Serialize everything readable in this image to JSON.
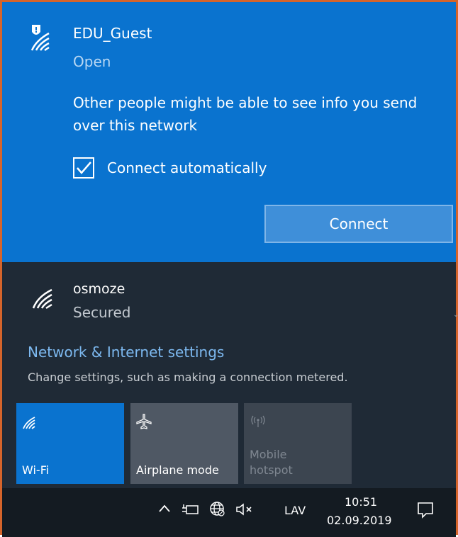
{
  "selected_network": {
    "ssid": "EDU_Guest",
    "status": "Open",
    "warning": "Other people might be able to see info you send over this network",
    "connect_automatically_label": "Connect automatically",
    "connect_automatically_checked": true,
    "connect_button_label": "Connect",
    "icon": "wifi-shield-warning-icon"
  },
  "networks": [
    {
      "ssid": "osmoze",
      "status": "Secured",
      "icon": "wifi-icon"
    }
  ],
  "settings": {
    "link_label": "Network & Internet settings",
    "description": "Change settings, such as making a connection metered."
  },
  "quick_actions": [
    {
      "label": "Wi-Fi",
      "icon": "wifi-icon",
      "active": true
    },
    {
      "label": "Airplane mode",
      "icon": "airplane-icon",
      "active": false
    },
    {
      "label_line1": "Mobile",
      "label_line2": "hotspot",
      "icon": "hotspot-icon",
      "disabled": true
    }
  ],
  "taskbar": {
    "language": "LAV",
    "time": "10:51",
    "date": "02.09.2019"
  },
  "colors": {
    "accent": "#0a73cf",
    "panel_background": "#1f2a36",
    "taskbar_background": "#141b22",
    "link": "#7db9f0",
    "window_border": "#d5642b"
  }
}
